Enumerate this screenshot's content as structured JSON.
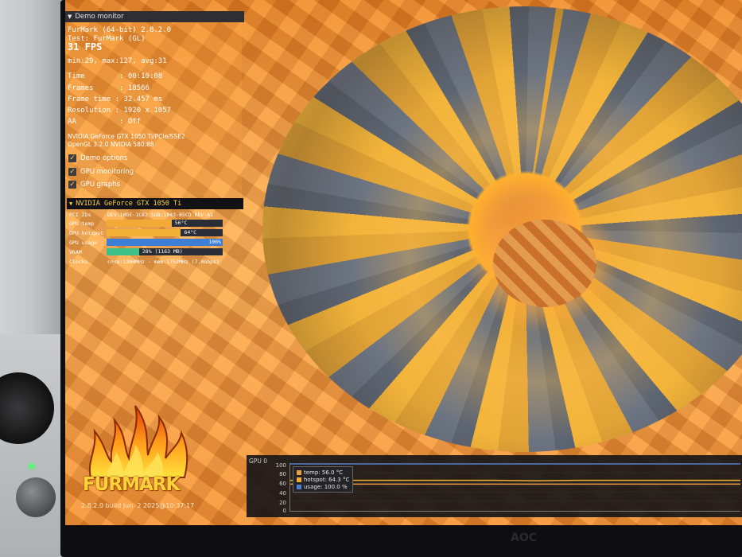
{
  "panel": {
    "header": "Demo monitor",
    "app_title": "FurMark (64-bit) 2.8.2.0",
    "test": "Test: FurMark (GL)",
    "fps": "31 FPS",
    "fps_stats": "min:29, max:127, avg:31",
    "time": "Time        : 00:10:08",
    "frames": "Frames      : 18566",
    "frame_time": "Frame time : 32.457 ms",
    "resolution": "Resolution : 1920 x 1057",
    "aa": "AA          : Off",
    "gpu_line1": "NVIDIA GeForce GTX 1050 Ti/PCIe/SSE2",
    "gpu_line2": "OpenGL 3.2.0 NVIDIA 580.88",
    "options": [
      "Demo options",
      "GPU monitoring",
      "GPU graphs"
    ]
  },
  "gpu": {
    "name": "NVIDIA GeForce GTX 1050 Ti",
    "pci_label": "PCI IDs",
    "pci_value": "DEV:10DE-1C82 SUB:1043-85CD REV:A1",
    "temp_label": "GPU temp",
    "temp_text": "56°C",
    "temp_level": 0.56,
    "hotspot_label": "GPU hotspot",
    "hotspot_text": "64°C",
    "hotspot_level": 0.64,
    "usage_label": "GPU usage",
    "usage_text": "100%",
    "usage_level": 1.0,
    "vram_label": "VRAM",
    "vram_text": "28% (1163 MB)",
    "vram_level": 0.28,
    "clocks_label": "Clocks",
    "clocks_value": "core:1304MHz - mem:1752MHz (7.0Gbps)"
  },
  "logo": {
    "text": "FURMARK",
    "build": "2.8.2.0 build Jun  2 2025@10:37:17"
  },
  "chart_data": {
    "type": "line",
    "title": "GPU 0",
    "ylim": [
      0,
      100
    ],
    "yticks": [
      "100",
      "80",
      "60",
      "40",
      "20",
      "0"
    ],
    "legend_placement": "top-left",
    "series": [
      {
        "name": "temp: 56.0 °C",
        "color": "#e8a040",
        "values": [
          56,
          56,
          56,
          56,
          56,
          56,
          56,
          56,
          56,
          56,
          56,
          56
        ]
      },
      {
        "name": "hotspot: 64.3 °C",
        "color": "#f0b030",
        "values": [
          64,
          64,
          64,
          64,
          64,
          64,
          63,
          64,
          64,
          64,
          64,
          64
        ]
      },
      {
        "name": "usage: 100.0 %",
        "color": "#4f7fd0",
        "values": [
          100,
          100,
          100,
          100,
          100,
          100,
          100,
          100,
          100,
          100,
          100,
          100
        ]
      }
    ]
  },
  "colors": {
    "bar_temp": "#f3a935",
    "bar_hotspot": "#f3b136",
    "bar_usage": "#3d7ed6",
    "bar_vram": "#3fc28a",
    "accent": "#ffd34a"
  },
  "bezel": {
    "logo": "AOC"
  }
}
